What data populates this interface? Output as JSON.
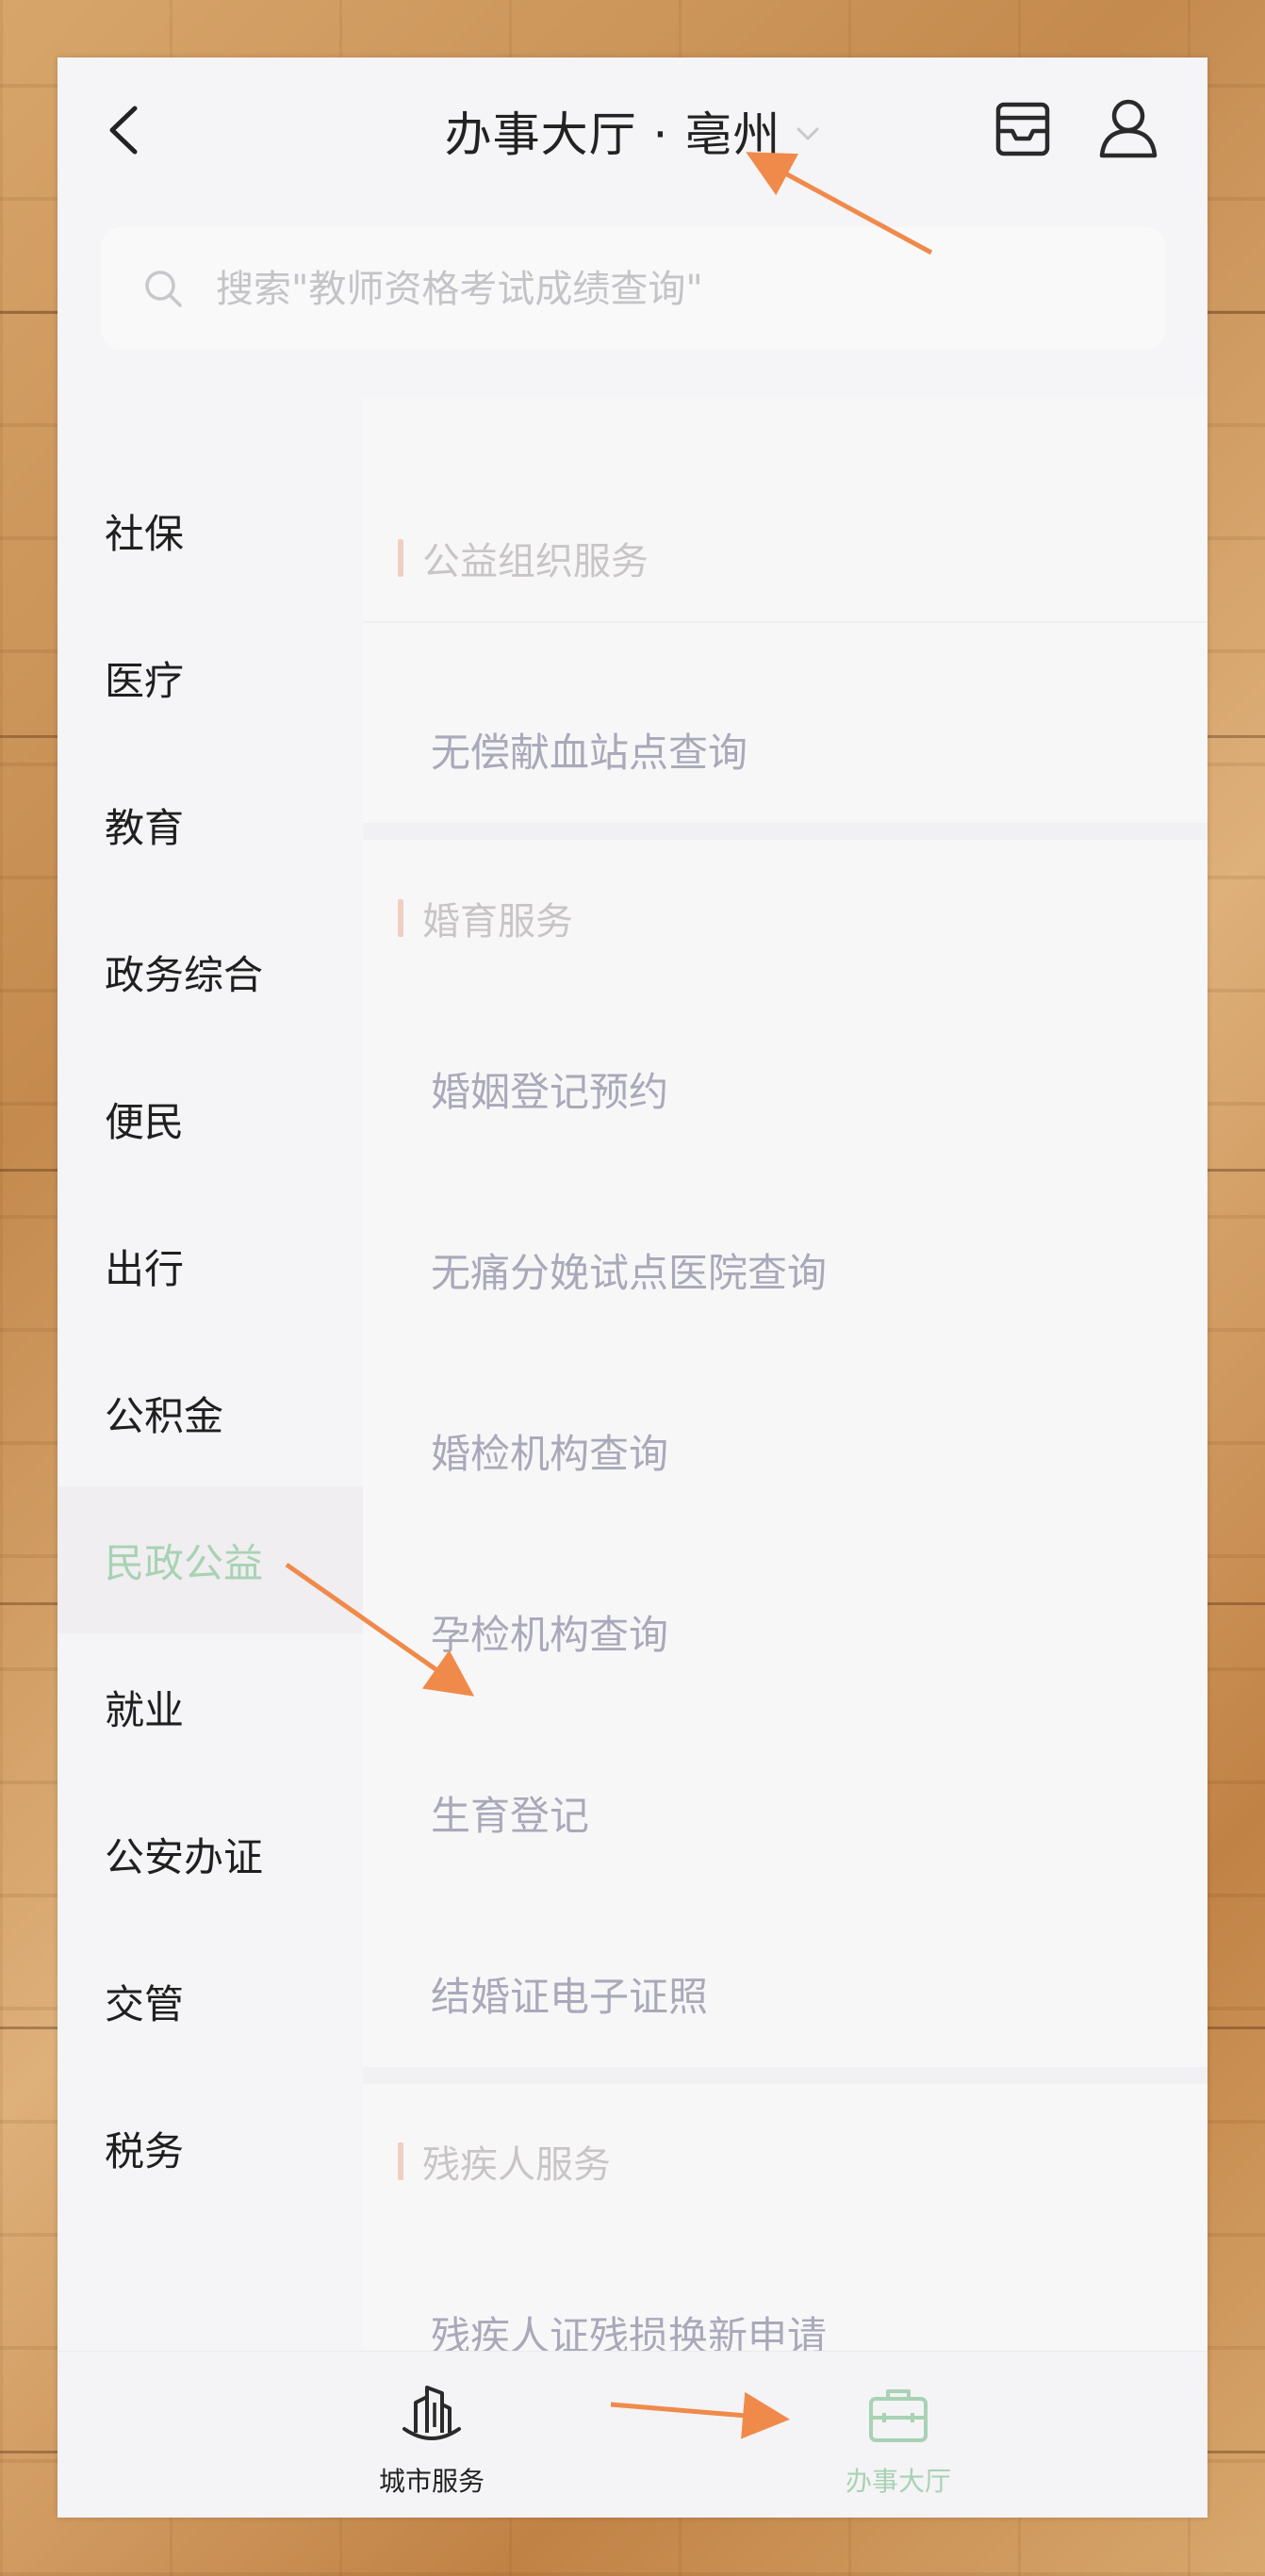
{
  "header": {
    "title": "办事大厅 · 亳州"
  },
  "search": {
    "placeholder": "搜索\"教师资格考试成绩查询\""
  },
  "sidebar": {
    "items": [
      {
        "label": "社保"
      },
      {
        "label": "医疗"
      },
      {
        "label": "教育"
      },
      {
        "label": "政务综合"
      },
      {
        "label": "便民"
      },
      {
        "label": "出行"
      },
      {
        "label": "公积金"
      },
      {
        "label": "民政公益",
        "active": true
      },
      {
        "label": "就业"
      },
      {
        "label": "公安办证"
      },
      {
        "label": "交管"
      },
      {
        "label": "税务"
      }
    ]
  },
  "content": {
    "sections": [
      {
        "title": "公益组织服务",
        "items": [
          "无偿献血站点查询"
        ]
      },
      {
        "title": "婚育服务",
        "items": [
          "婚姻登记预约",
          "无痛分娩试点医院查询",
          "婚检机构查询",
          "孕检机构查询",
          "生育登记",
          "结婚证电子证照"
        ]
      },
      {
        "title": "残疾人服务",
        "items": [
          "残疾人证残损换新申请"
        ]
      }
    ]
  },
  "tabbar": {
    "city": "城市服务",
    "hall": "办事大厅"
  },
  "colors": {
    "active_green": "#a8d2b4",
    "annotation_arrow": "#f08a4b",
    "section_bar": "#f2cdc2"
  },
  "icons": [
    "back-chevron-icon",
    "dropdown-chevron-icon",
    "inbox-icon",
    "user-icon",
    "search-icon",
    "city-buildings-icon",
    "briefcase-icon"
  ]
}
